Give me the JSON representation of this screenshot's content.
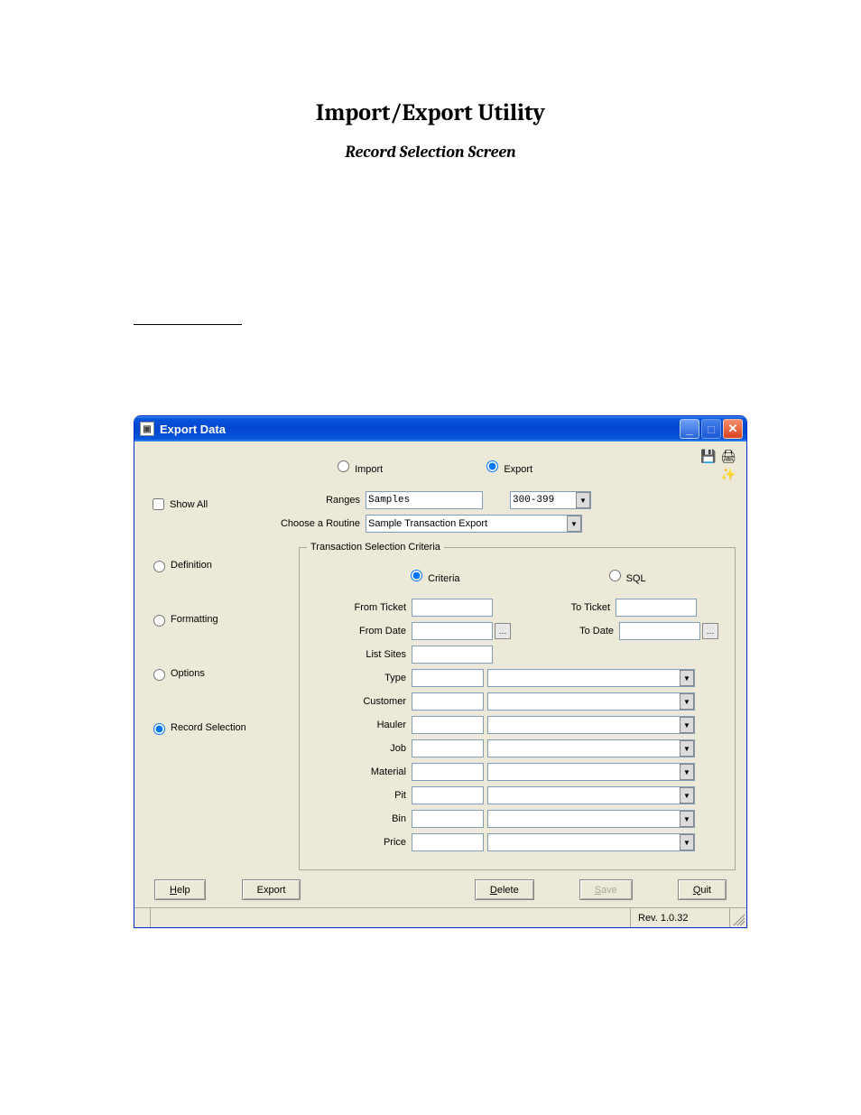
{
  "doc": {
    "title": "Import/Export Utility",
    "subtitle": "Record Selection Screen"
  },
  "window": {
    "title": "Export Data"
  },
  "toolbar": {
    "save_icon": "save-icon",
    "printer_icon": "printer-icon",
    "wizard_icon": "wizard-icon"
  },
  "mode": {
    "import_label": "Import",
    "export_label": "Export",
    "selected": "Export"
  },
  "ranges": {
    "label": "Ranges",
    "name_value": "Samples",
    "range_value": "300-399"
  },
  "routine": {
    "label": "Choose a Routine",
    "value": "Sample Transaction Export"
  },
  "show_all": {
    "label": "Show All",
    "checked": false
  },
  "nav": {
    "definition": "Definition",
    "formatting": "Formatting",
    "options": "Options",
    "record_selection": "Record Selection",
    "selected": "Record Selection"
  },
  "criteria_group": {
    "legend": "Transaction Selection Criteria",
    "mode": {
      "criteria": "Criteria",
      "sql": "SQL",
      "selected": "Criteria"
    },
    "from_ticket_label": "From Ticket",
    "to_ticket_label": "To Ticket",
    "from_date_label": "From Date",
    "to_date_label": "To Date",
    "list_sites_label": "List Sites",
    "type_label": "Type",
    "customer_label": "Customer",
    "hauler_label": "Hauler",
    "job_label": "Job",
    "material_label": "Material",
    "pit_label": "Pit",
    "bin_label": "Bin",
    "price_label": "Price",
    "from_ticket": "",
    "to_ticket": "",
    "from_date": "",
    "to_date": "",
    "list_sites": "",
    "type": "",
    "customer": "",
    "hauler": "",
    "job": "",
    "material": "",
    "pit": "",
    "bin": "",
    "price": ""
  },
  "buttons": {
    "help": "Help",
    "export": "Export",
    "delete": "Delete",
    "save": "Save",
    "quit": "Quit"
  },
  "status": {
    "rev": "Rev. 1.0.32"
  }
}
